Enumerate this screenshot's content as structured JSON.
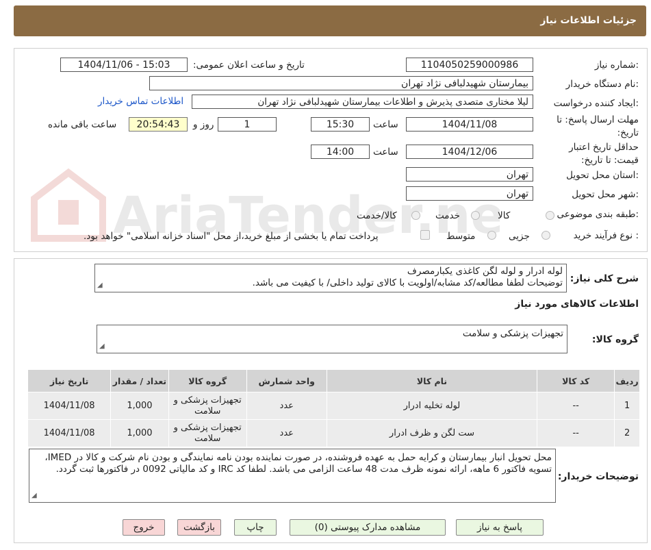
{
  "header": {
    "title": "جزئیات اطلاعات نیاز"
  },
  "form": {
    "need_number_label": "شماره نیاز:",
    "need_number": "1104050259000986",
    "announce_label": "تاریخ و ساعت اعلان عمومی:",
    "announce_value": "1404/11/06 - 15:03",
    "buyer_label": "نام دستگاه خریدار:",
    "buyer_value": "بیمارستان شهیدلبافی نژاد تهران",
    "creator_label": "ایجاد کننده درخواست:",
    "creator_value": "لیلا مختاری متصدی پذیرش و اطلاعات بیمارستان شهیدلبافی نژاد تهران",
    "contact_link": "اطلاعات تماس خریدار",
    "deadline_label": "مهلت ارسال پاسخ: تا تاریخ:",
    "deadline_date": "1404/11/08",
    "time_label": "ساعت",
    "deadline_time": "15:30",
    "days_value": "1",
    "days_label": "روز و",
    "remaining_time": "20:54:43",
    "remaining_label": "ساعت باقی مانده",
    "validity_label": "حداقل تاریخ اعتبار قیمت: تا تاریخ:",
    "validity_date": "1404/12/06",
    "validity_time": "14:00",
    "province_label": "استان محل تحویل:",
    "province_value": "تهران",
    "city_label": "شهر محل تحویل:",
    "city_value": "تهران",
    "category_label": "طبقه بندی موضوعی:",
    "category_options": [
      "کالا",
      "خدمت",
      "کالا/خدمت"
    ],
    "process_label": "نوع فرآیند خرید :",
    "process_options": [
      "جزیی",
      "متوسط"
    ],
    "treasury_note": "پرداخت تمام یا بخشی از مبلغ خرید،از محل \"اسناد خزانه اسلامی\" خواهد بود."
  },
  "summary": {
    "label": "شرح کلی نیاز:",
    "line1": "لوله ادرار و لوله لگن کاغذی یکبارمصرف",
    "line2": "توضیحات لطفا مطالعه/کد مشابه/اولویت با کالای تولید داخلی/ با کیفیت می باشد.",
    "items_title": "اطلاعات کالاهای مورد نیاز",
    "group_label": "گروه کالا:",
    "group_value": "تجهیزات پزشکی و سلامت"
  },
  "table": {
    "headers": [
      "ردیف",
      "کد کالا",
      "نام کالا",
      "واحد شمارش",
      "گروه کالا",
      "تعداد / مقدار",
      "تاریخ نیاز"
    ],
    "rows": [
      [
        "1",
        "--",
        "لوله تخلیه ادرار",
        "عدد",
        "تجهیزات پزشکی و سلامت",
        "1,000",
        "1404/11/08"
      ],
      [
        "2",
        "--",
        "ست لگن و ظرف ادرار",
        "عدد",
        "تجهیزات پزشکی و سلامت",
        "1,000",
        "1404/11/08"
      ]
    ]
  },
  "buyer_notes": {
    "label": "توضیحات خریدار:",
    "text": "محل تحویل انبار بیمارستان و کرایه حمل به عهده فروشنده، در صورت نماینده بودن نامه نمایندگی و بودن نام شرکت و کالا در IMED، تسویه فاکتور 6 ماهه، ارائه نمونه ظرف مدت 48 ساعت الزامی می باشد. لطفا کد IRC و کد مالیاتی 0092 در فاکتورها ثبت گردد."
  },
  "buttons": {
    "reply": "پاسخ به نیاز",
    "attachments": "مشاهده مدارک پیوستی (0)",
    "print": "چاپ",
    "back": "بازگشت",
    "exit": "خروج"
  },
  "watermark": {
    "text": "AriaTender.neT"
  },
  "colors": {
    "header": "#8b6b43",
    "link": "#1a55c8",
    "timer_bg": "#ffffcc",
    "button_green": "#eaf7e1",
    "button_red": "#f8d6d6"
  }
}
